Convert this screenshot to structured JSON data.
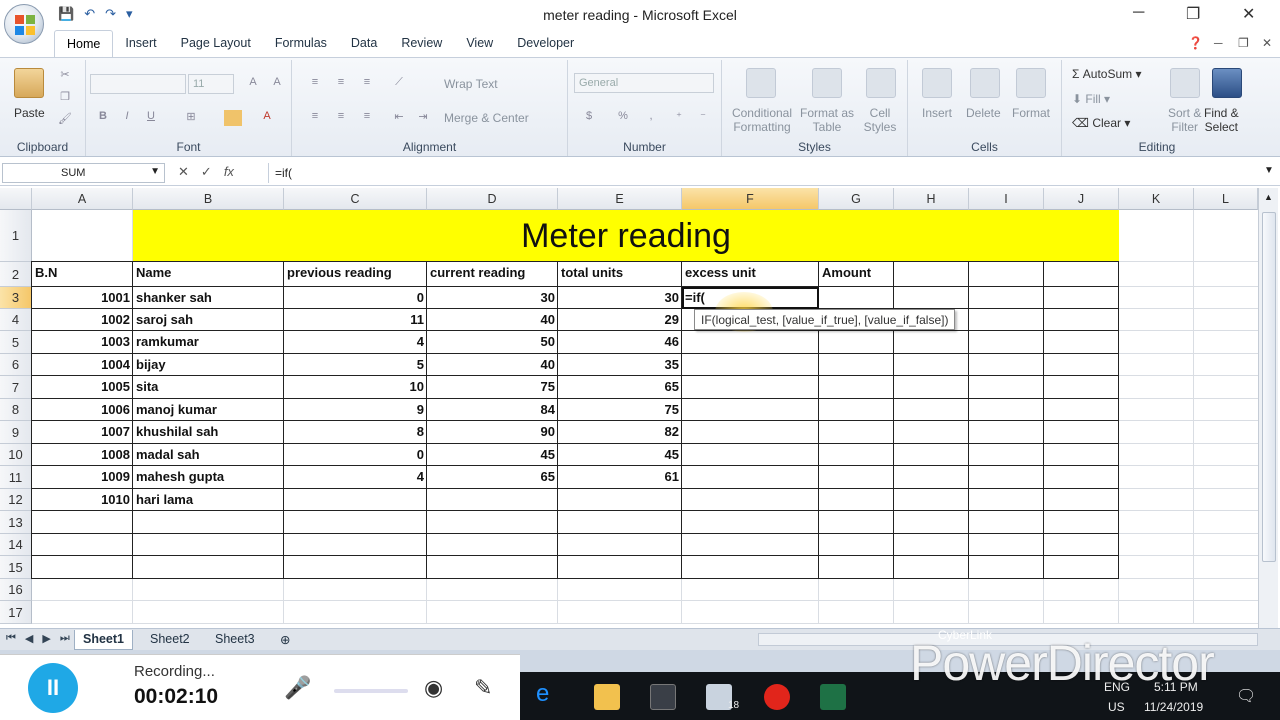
{
  "window": {
    "title": "meter reading - Microsoft Excel",
    "min": "─",
    "restore": "❐",
    "close": "✕"
  },
  "qat": {
    "save": "💾",
    "undo": "↶",
    "redo": "↷",
    "customize": "▾"
  },
  "tabs": [
    "Home",
    "Insert",
    "Page Layout",
    "Formulas",
    "Data",
    "Review",
    "View",
    "Developer"
  ],
  "ribbon": {
    "clipboard": {
      "label": "Clipboard",
      "paste": "Paste"
    },
    "font": {
      "label": "Font",
      "size": "11",
      "bold": "B",
      "italic": "I",
      "underline": "U"
    },
    "alignment": {
      "label": "Alignment",
      "wrap": "Wrap Text",
      "merge": "Merge & Center"
    },
    "number": {
      "label": "Number",
      "format": "General",
      "currency": "$",
      "percent": "%"
    },
    "styles": {
      "label": "Styles",
      "conditional": "Conditional",
      "conditional2": "Formatting",
      "format_as": "Format as",
      "format_as2": "Table",
      "cell": "Cell",
      "cell2": "Styles"
    },
    "cells": {
      "label": "Cells",
      "insert": "Insert",
      "delete": "Delete",
      "format": "Format"
    },
    "editing": {
      "label": "Editing",
      "autosum": "AutoSum",
      "fill": "Fill",
      "clear": "Clear",
      "sort": "Sort &",
      "sort2": "Filter",
      "find": "Find &",
      "find2": "Select"
    }
  },
  "formula_bar": {
    "name_box": "SUM",
    "formula": "=if("
  },
  "columns": [
    "A",
    "B",
    "C",
    "D",
    "E",
    "F",
    "G",
    "H",
    "I",
    "J",
    "K",
    "L"
  ],
  "rows": [
    "1",
    "2",
    "3",
    "4",
    "5",
    "6",
    "7",
    "8",
    "9",
    "10",
    "11",
    "12",
    "13",
    "14",
    "15",
    "16",
    "17"
  ],
  "sheet": {
    "title": "Meter reading",
    "headers": [
      "B.N",
      "Name",
      "previous reading",
      "current reading",
      "total  units",
      "excess unit",
      "Amount"
    ],
    "data": [
      {
        "bn": "1001",
        "name": "shanker sah",
        "prev": "0",
        "curr": "30",
        "total": "30"
      },
      {
        "bn": "1002",
        "name": "saroj sah",
        "prev": "11",
        "curr": "40",
        "total": "29"
      },
      {
        "bn": "1003",
        "name": "ramkumar",
        "prev": "4",
        "curr": "50",
        "total": "46"
      },
      {
        "bn": "1004",
        "name": "bijay",
        "prev": "5",
        "curr": "40",
        "total": "35"
      },
      {
        "bn": "1005",
        "name": "sita",
        "prev": "10",
        "curr": "75",
        "total": "65"
      },
      {
        "bn": "1006",
        "name": "manoj kumar",
        "prev": "9",
        "curr": "84",
        "total": "75"
      },
      {
        "bn": "1007",
        "name": "khushilal sah",
        "prev": "8",
        "curr": "90",
        "total": "82"
      },
      {
        "bn": "1008",
        "name": "madal sah",
        "prev": "0",
        "curr": "45",
        "total": "45"
      },
      {
        "bn": "1009",
        "name": "mahesh gupta",
        "prev": "4",
        "curr": "65",
        "total": "61"
      },
      {
        "bn": "1010",
        "name": "hari lama",
        "prev": "",
        "curr": "",
        "total": ""
      }
    ],
    "editing_cell": "=if(",
    "tooltip": "IF(logical_test, [value_if_true], [value_if_false])"
  },
  "sheet_tabs": [
    "Sheet1",
    "Sheet2",
    "Sheet3"
  ],
  "recorder": {
    "label": "Recording...",
    "time": "00:02:10",
    "pause": "II"
  },
  "watermark": {
    "small": "CyberLink",
    "big": "PowerDirector"
  },
  "tray": {
    "lang": "ENG",
    "region": "US",
    "time": "5:11 PM",
    "date": "11/24/2019",
    "mail_badge": "18"
  },
  "colors": {
    "title_fill": "#ffff00",
    "selection": "#f5c769",
    "accent": "#2a5ea0"
  }
}
